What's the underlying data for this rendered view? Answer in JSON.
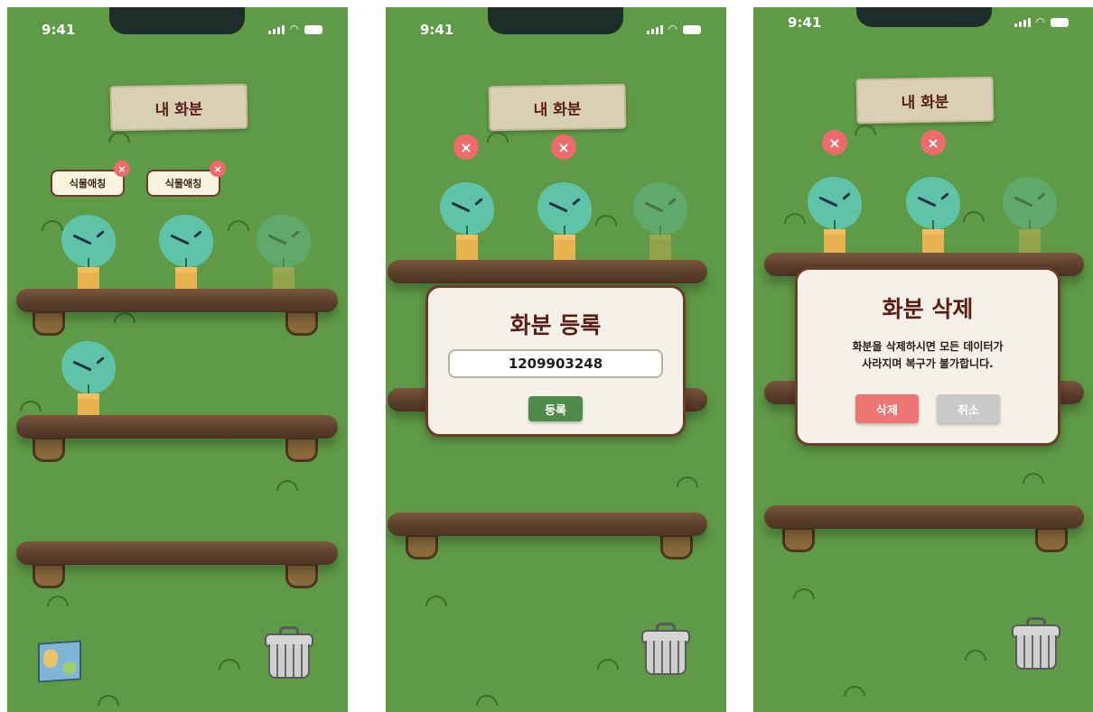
{
  "statusbar": {
    "time": "9:41"
  },
  "header": {
    "title": "내 화분"
  },
  "screen1": {
    "tags": [
      {
        "label": "식물애칭"
      },
      {
        "label": "식물애칭"
      }
    ],
    "close_symbol": "×"
  },
  "register_modal": {
    "title": "화분 등록",
    "input_value": "1209903248",
    "submit_label": "등록"
  },
  "delete_modal": {
    "title": "화분 삭제",
    "message_line1": "화분을 삭제하시면 모든 데이터가",
    "message_line2": "사라지며 복구가 불가합니다.",
    "confirm_label": "삭제",
    "cancel_label": "취소"
  },
  "icons": {
    "close": "close-icon",
    "trash": "trash-can-icon",
    "map": "map-icon"
  },
  "colors": {
    "background": "#5f9a46",
    "title_text": "#5a1e16",
    "close_badge": "#ee6b6b",
    "register_button": "#4e8a4a",
    "delete_button": "#ef7474",
    "cancel_button": "#c9c9c9"
  }
}
